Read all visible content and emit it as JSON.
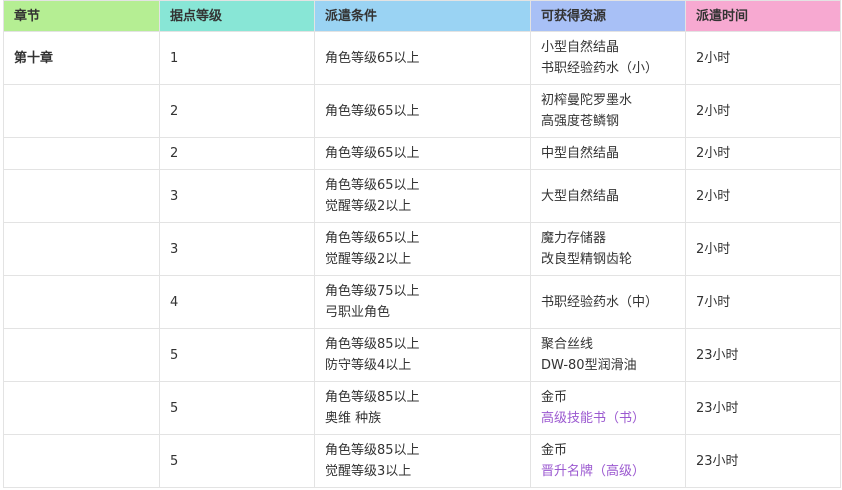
{
  "table": {
    "headers": [
      "章节",
      "据点等级",
      "派遣条件",
      "可获得资源",
      "派遣时间"
    ],
    "header_colors": [
      "#b5ee93",
      "#88e6d6",
      "#9ad3f3",
      "#a8c0f6",
      "#f7a9d1"
    ],
    "highlight_color": "#9b59d0",
    "rows": [
      {
        "chapter": "第十章",
        "level": "1",
        "conditions": [
          "角色等级65以上"
        ],
        "resources": [
          {
            "text": "小型自然结晶",
            "highlight": false
          },
          {
            "text": "书职经验药水（小）",
            "highlight": false
          }
        ],
        "time": "2小时"
      },
      {
        "chapter": "",
        "level": "2",
        "conditions": [
          "角色等级65以上"
        ],
        "resources": [
          {
            "text": "初榨曼陀罗墨水",
            "highlight": false
          },
          {
            "text": "高强度苍鳞钢",
            "highlight": false
          }
        ],
        "time": "2小时"
      },
      {
        "chapter": "",
        "level": "2",
        "conditions": [
          "角色等级65以上"
        ],
        "resources": [
          {
            "text": "中型自然结晶",
            "highlight": false
          }
        ],
        "time": "2小时"
      },
      {
        "chapter": "",
        "level": "3",
        "conditions": [
          "角色等级65以上",
          "觉醒等级2以上"
        ],
        "resources": [
          {
            "text": "大型自然结晶",
            "highlight": false
          }
        ],
        "time": "2小时"
      },
      {
        "chapter": "",
        "level": "3",
        "conditions": [
          "角色等级65以上",
          "觉醒等级2以上"
        ],
        "resources": [
          {
            "text": "魔力存储器",
            "highlight": false
          },
          {
            "text": "改良型精钢齿轮",
            "highlight": false
          }
        ],
        "time": "2小时"
      },
      {
        "chapter": "",
        "level": "4",
        "conditions": [
          "角色等级75以上",
          "弓职业角色"
        ],
        "resources": [
          {
            "text": "书职经验药水（中）",
            "highlight": false
          }
        ],
        "time": "7小时"
      },
      {
        "chapter": "",
        "level": "5",
        "conditions": [
          "角色等级85以上",
          "防守等级4以上"
        ],
        "resources": [
          {
            "text": "聚合丝线",
            "highlight": false
          },
          {
            "text": "DW-80型润滑油",
            "highlight": false
          }
        ],
        "time": "23小时"
      },
      {
        "chapter": "",
        "level": "5",
        "conditions": [
          "角色等级85以上",
          "奥维 种族"
        ],
        "resources": [
          {
            "text": "金币",
            "highlight": false
          },
          {
            "text": "高级技能书（书）",
            "highlight": true
          }
        ],
        "time": "23小时"
      },
      {
        "chapter": "",
        "level": "5",
        "conditions": [
          "角色等级85以上",
          "觉醒等级3以上"
        ],
        "resources": [
          {
            "text": "金币",
            "highlight": false
          },
          {
            "text": "晋升名牌（高级）",
            "highlight": true
          }
        ],
        "time": "23小时"
      }
    ]
  }
}
